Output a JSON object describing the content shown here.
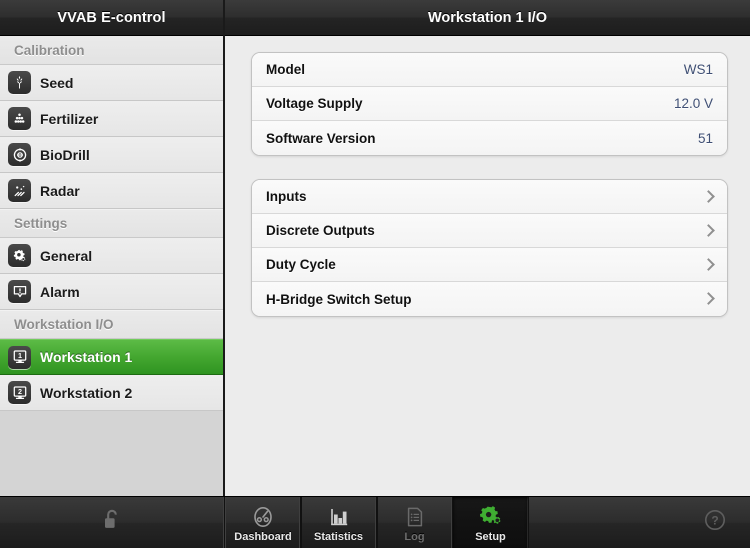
{
  "sidebar": {
    "title": "VVAB E-control",
    "sections": [
      {
        "heading": "Calibration",
        "items": [
          {
            "label": "Seed",
            "icon": "seed-icon",
            "active": false
          },
          {
            "label": "Fertilizer",
            "icon": "fertilizer-icon",
            "active": false
          },
          {
            "label": "BioDrill",
            "icon": "biodrill-icon",
            "active": false
          },
          {
            "label": "Radar",
            "icon": "radar-icon",
            "active": false
          }
        ]
      },
      {
        "heading": "Settings",
        "items": [
          {
            "label": "General",
            "icon": "gears-icon",
            "active": false
          },
          {
            "label": "Alarm",
            "icon": "alarm-icon",
            "active": false
          }
        ]
      },
      {
        "heading": "Workstation I/O",
        "items": [
          {
            "label": "Workstation 1",
            "icon": "workstation-1-icon",
            "active": true
          },
          {
            "label": "Workstation 2",
            "icon": "workstation-2-icon",
            "active": false
          }
        ]
      }
    ]
  },
  "main": {
    "title": "Workstation 1 I/O",
    "info_rows": [
      {
        "key": "Model",
        "value": "WS1"
      },
      {
        "key": "Voltage Supply",
        "value": "12.0 V"
      },
      {
        "key": "Software Version",
        "value": "51"
      }
    ],
    "nav_rows": [
      {
        "label": "Inputs"
      },
      {
        "label": "Discrete Outputs"
      },
      {
        "label": "Duty Cycle"
      },
      {
        "label": "H-Bridge Switch Setup"
      }
    ]
  },
  "toolbar": {
    "lock_icon": "unlocked-padlock-icon",
    "help_icon": "help-question-icon",
    "tabs": [
      {
        "label": "Dashboard",
        "icon": "dashboard-gauge-icon",
        "active": false,
        "disabled": false
      },
      {
        "label": "Statistics",
        "icon": "bar-chart-icon",
        "active": false,
        "disabled": false
      },
      {
        "label": "Log",
        "icon": "log-document-icon",
        "active": false,
        "disabled": true
      },
      {
        "label": "Setup",
        "icon": "setup-gears-icon",
        "active": true,
        "disabled": false
      }
    ]
  },
  "colors": {
    "accent_green": "#43a62f",
    "value_blue": "#3f4f74",
    "header_dark": "#2b2b2b",
    "sidebar_bg": "#d4d4d4",
    "main_bg": "#ececec"
  }
}
